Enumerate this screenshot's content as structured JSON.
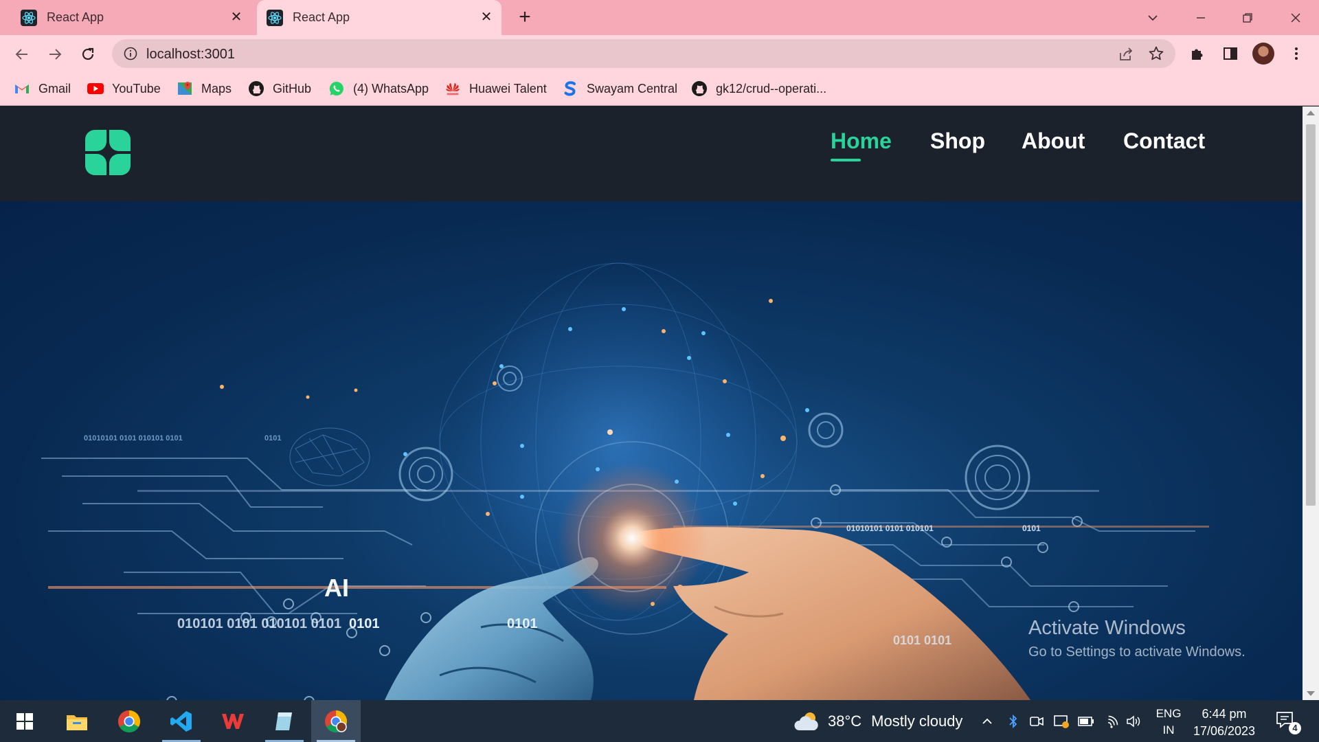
{
  "browser": {
    "tabs": [
      {
        "title": "React App",
        "active": false
      },
      {
        "title": "React App",
        "active": true
      }
    ],
    "address": "localhost:3001",
    "bookmarks": [
      {
        "label": "Gmail",
        "icon": "gmail-icon"
      },
      {
        "label": "YouTube",
        "icon": "youtube-icon"
      },
      {
        "label": "Maps",
        "icon": "maps-icon"
      },
      {
        "label": "GitHub",
        "icon": "github-icon"
      },
      {
        "label": "(4) WhatsApp",
        "icon": "whatsapp-icon"
      },
      {
        "label": "Huawei Talent",
        "icon": "huawei-icon"
      },
      {
        "label": "Swayam Central",
        "icon": "swayam-icon"
      },
      {
        "label": "gk12/crud--operati...",
        "icon": "github-icon"
      }
    ]
  },
  "site": {
    "nav": [
      {
        "label": "Home",
        "active": true
      },
      {
        "label": "Shop",
        "active": false
      },
      {
        "label": "About",
        "active": false
      },
      {
        "label": "Contact",
        "active": false
      }
    ],
    "brand_color": "#2ad39a",
    "header_bg": "#1b222c",
    "hero": {
      "ai_text": "AI",
      "binary": [
        "01010101 0101 010101 0101",
        "0101",
        "0101",
        "01010101 0101 010101",
        "0101",
        "0101",
        "010101 0101 010101 0101",
        "0101 0101"
      ]
    }
  },
  "os": {
    "watermark_title": "Activate Windows",
    "watermark_sub": "Go to Settings to activate Windows.",
    "weather_temp": "38°C",
    "weather_text": "Mostly cloudy",
    "lang_line1": "ENG",
    "lang_line2": "IN",
    "time": "6:44 pm",
    "date": "17/06/2023",
    "notification_count": "4"
  }
}
